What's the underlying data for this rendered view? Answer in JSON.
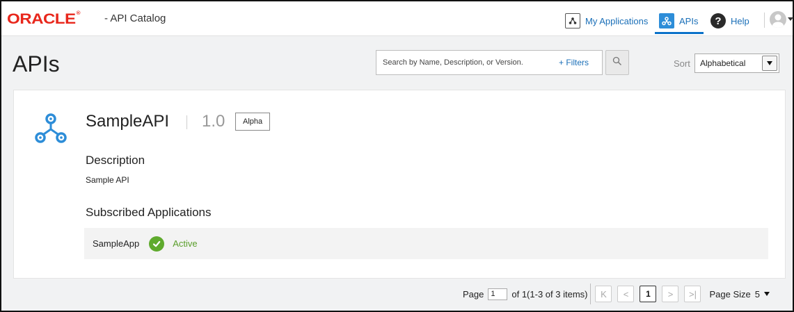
{
  "header": {
    "logo": "ORACLE",
    "logo_tm": "®",
    "app_title": "- API Catalog",
    "nav": {
      "my_applications": "My Applications",
      "apis": "APIs",
      "help": "Help"
    }
  },
  "page": {
    "title": "APIs",
    "search": {
      "placeholder": "Search by Name, Description, or Version.",
      "filters_label": "+ Filters"
    },
    "sort": {
      "label": "Sort",
      "selected": "Alphabetical"
    }
  },
  "api_card": {
    "name": "SampleAPI",
    "version": "1.0",
    "badge": "Alpha",
    "description_heading": "Description",
    "description": "Sample API",
    "subscribed_heading": "Subscribed Applications",
    "subscriptions": [
      {
        "app": "SampleApp",
        "status": "Active"
      }
    ]
  },
  "pagination": {
    "page_label": "Page",
    "current_page": "1",
    "of_text": "of 1(1-3 of 3 items)",
    "first": "K",
    "prev": "<",
    "page_button": "1",
    "next": ">",
    "last": ">|",
    "page_size_label": "Page Size",
    "page_size": "5"
  },
  "colors": {
    "brand_red": "#e8271c",
    "link_blue": "#1a6fb8",
    "active_green": "#5faa2d"
  }
}
